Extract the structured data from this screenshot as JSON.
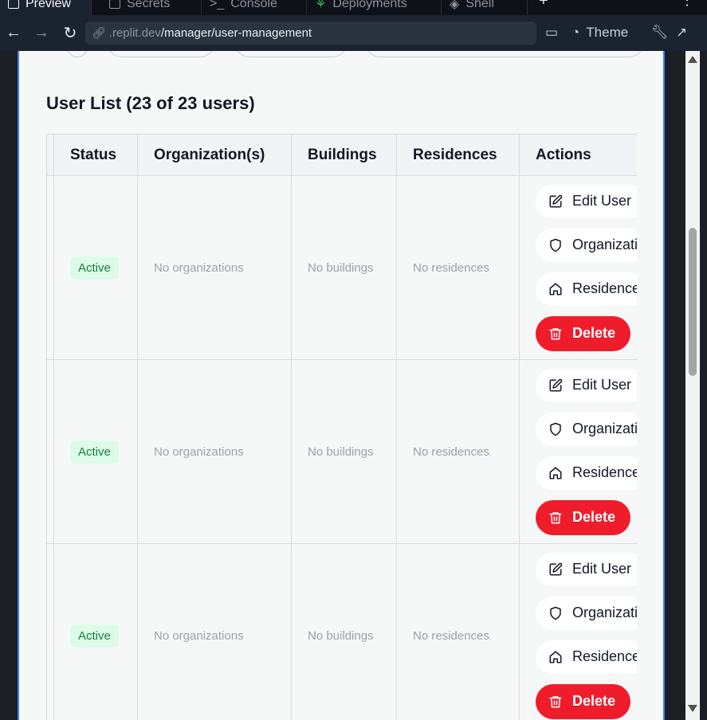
{
  "browser": {
    "tabs": [
      {
        "label": "Preview",
        "active": true
      },
      {
        "label": "Secrets",
        "active": false
      },
      {
        "label": "Console",
        "active": false
      },
      {
        "label": "Deployments",
        "active": false
      },
      {
        "label": "Shell",
        "active": false
      }
    ],
    "url_host": ".replit.dev",
    "url_path": "/manager/user-management",
    "theme_label": "Theme"
  },
  "page": {
    "list_title": "User List (23 of 23 users)",
    "columns": [
      "Status",
      "Organization(s)",
      "Buildings",
      "Residences",
      "Actions"
    ],
    "rows": [
      {
        "status": "Active",
        "organizations": "No organizations",
        "buildings": "No buildings",
        "residences": "No residences"
      },
      {
        "status": "Active",
        "organizations": "No organizations",
        "buildings": "No buildings",
        "residences": "No residences"
      },
      {
        "status": "Active",
        "organizations": "No organizations",
        "buildings": "No buildings",
        "residences": "No residences"
      }
    ],
    "actions": {
      "edit": "Edit User",
      "organizations": "Organizations",
      "residences": "Residences",
      "delete": "Delete"
    }
  },
  "colors": {
    "accent_border": "#3b82f6",
    "active_badge_bg": "#dcfce7",
    "active_badge_text": "#15803d",
    "delete_bg": "#ef1c2c"
  }
}
